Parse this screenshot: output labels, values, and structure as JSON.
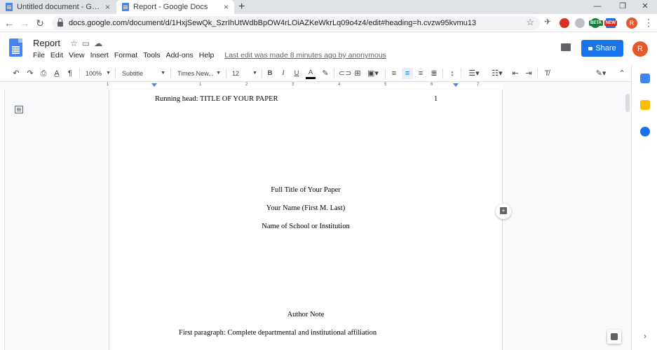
{
  "browser": {
    "tabs": [
      {
        "title": "Untitled document - Google Doc",
        "close": "×"
      },
      {
        "title": "Report - Google Docs",
        "close": "×"
      }
    ],
    "new_tab": "+",
    "window_controls": {
      "minimize": "—",
      "restore": "❐",
      "close": "✕"
    },
    "url": "docs.google.com/document/d/1HxjSewQk_SzrIhUtWdbBpOW4rLOiAZKeWkrLq09o4z4/edit#heading=h.cvzw95kvmu13",
    "extensions": [
      {
        "name": "extension-bird-icon",
        "color": "#5f6368"
      },
      {
        "name": "extension-opera-icon",
        "color": "#d93025"
      },
      {
        "name": "extension-speed-icon",
        "color": "#9aa0a6"
      },
      {
        "name": "extension-beta-icon",
        "color": "#188038",
        "label": "BETA"
      },
      {
        "name": "extension-new-icon",
        "color": "#1a73e8",
        "label": "NEW"
      }
    ],
    "profile_initial": "R"
  },
  "docs": {
    "title": "Report",
    "menu": [
      "File",
      "Edit",
      "View",
      "Insert",
      "Format",
      "Tools",
      "Add-ons",
      "Help"
    ],
    "last_edit": "Last edit was made 8 minutes ago by anonymous",
    "share_label": "Share",
    "profile_initial": "R",
    "toolbar": {
      "zoom": "100%",
      "style": "Subtitle",
      "font": "Times New...",
      "size": "12",
      "bold": "B",
      "italic": "I",
      "underline": "U",
      "text_color": "A"
    },
    "ruler_numbers": [
      "1",
      "1",
      "2",
      "3",
      "4",
      "5",
      "6",
      "7"
    ]
  },
  "page": {
    "running_head": "Running head: TITLE OF YOUR PAPER",
    "page_number": "1",
    "full_title": "Full Title of Your Paper",
    "author": "Your Name (First M. Last)",
    "school": "Name of School or Institution",
    "author_note": "Author Note",
    "first_paragraph": "First paragraph: Complete departmental and institutional affiliation"
  },
  "colors": {
    "accent": "#1a73e8",
    "avatar": "#e8572a",
    "calendar": "#4285f4",
    "keep": "#fbbc04",
    "tasks": "#1a73e8"
  }
}
